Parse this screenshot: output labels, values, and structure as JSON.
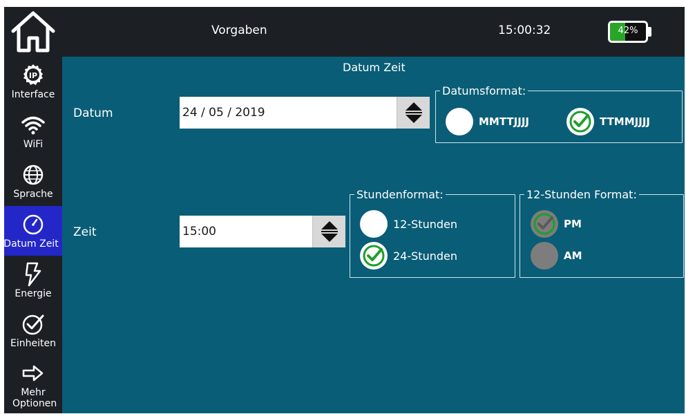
{
  "topbar": {
    "title": "Vorgaben",
    "clock": "15:00:32",
    "battery_label": "42%",
    "battery_level": 0.42
  },
  "sidebar": {
    "items": [
      {
        "label": "Interface",
        "icon": "ip-icon"
      },
      {
        "label": "WiFi",
        "icon": "wifi-icon"
      },
      {
        "label": "Sprache",
        "icon": "globe-icon"
      },
      {
        "label": "Datum Zeit",
        "icon": "clock-icon",
        "active": true
      },
      {
        "label": "Energie",
        "icon": "lightning-icon"
      },
      {
        "label": "Einheiten",
        "icon": "check-circle-icon"
      },
      {
        "label": "Mehr Optionen",
        "icon": "arrow-right-icon"
      }
    ]
  },
  "main": {
    "title": "Datum Zeit",
    "date": {
      "label": "Datum",
      "value": "24 / 05 / 2019",
      "format_group": {
        "legend": "Datumsformat:",
        "options": [
          {
            "label": "MMTTJJJJ",
            "checked": false
          },
          {
            "label": "TTMMJJJJ",
            "checked": true
          }
        ]
      }
    },
    "time": {
      "label": "Zeit",
      "value": "15:00",
      "hour_format_group": {
        "legend": "Stundenformat:",
        "options": [
          {
            "label": "12-Stunden",
            "checked": false
          },
          {
            "label": "24-Stunden",
            "checked": true
          }
        ]
      },
      "ampm_group": {
        "legend": "12-Stunden Format:",
        "options": [
          {
            "label": "PM",
            "checked": true
          },
          {
            "label": "AM",
            "checked": false
          }
        ]
      }
    }
  },
  "colors": {
    "background": "#0a5d76",
    "bar": "#1c2025",
    "active_item": "#2327c8",
    "check_green": "#1e9e2a",
    "battery_green": "#28a628"
  }
}
